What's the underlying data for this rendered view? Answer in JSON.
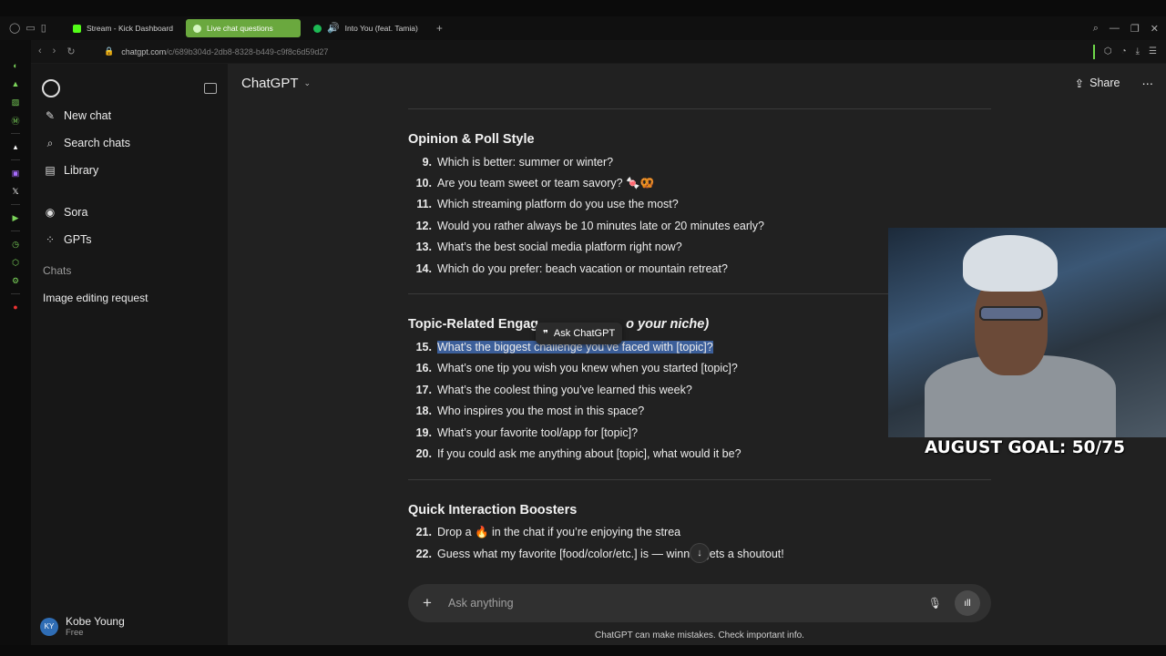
{
  "browser": {
    "tabs": [
      {
        "label": "Stream - Kick Dashboard"
      },
      {
        "label": "Live chat questions"
      },
      {
        "label": "Into You (feat. Tamia)"
      }
    ],
    "url_host": "chatgpt.com",
    "url_path": "/c/689b304d-2db8-8328-b449-c9f8c6d59d27"
  },
  "sidebar": {
    "items": [
      {
        "label": "New chat",
        "icon": "pencil-icon"
      },
      {
        "label": "Search chats",
        "icon": "search-icon"
      },
      {
        "label": "Library",
        "icon": "library-icon"
      },
      {
        "label": "Sora",
        "icon": "sora-icon"
      },
      {
        "label": "GPTs",
        "icon": "grid-icon"
      }
    ],
    "chats_heading": "Chats",
    "chats": [
      "Image editing request"
    ],
    "user": {
      "initials": "KY",
      "name": "Kobe Young",
      "plan": "Free"
    }
  },
  "header": {
    "model": "ChatGPT",
    "share_label": "Share"
  },
  "content": {
    "section1_title": "Opinion & Poll Style",
    "section1_items": [
      {
        "n": "9.",
        "text": "Which is better: summer or winter?"
      },
      {
        "n": "10.",
        "text": "Are you team sweet or team savory? 🍬🥨"
      },
      {
        "n": "11.",
        "text": "Which streaming platform do you use the most?"
      },
      {
        "n": "12.",
        "text": "Would you rather always be 10 minutes late or 20 minutes early?"
      },
      {
        "n": "13.",
        "text": "What’s the best social media platform right now?"
      },
      {
        "n": "14.",
        "text": "Which do you prefer: beach vacation or mountain retreat?"
      }
    ],
    "section2_title_start": "Topic-Related Engag",
    "section2_title_end": "o your niche)",
    "section2_items": [
      {
        "n": "15.",
        "text": "What’s the biggest challenge you’ve faced with [topic]?"
      },
      {
        "n": "16.",
        "text": "What’s one tip you wish you knew when you started [topic]?"
      },
      {
        "n": "17.",
        "text": "What’s the coolest thing you’ve learned this week?"
      },
      {
        "n": "18.",
        "text": "Who inspires you the most in this space?"
      },
      {
        "n": "19.",
        "text": "What’s your favorite tool/app for [topic]?"
      },
      {
        "n": "20.",
        "text": "If you could ask me anything about [topic], what would it be?"
      }
    ],
    "section3_title": "Quick Interaction Boosters",
    "section3_items": [
      {
        "n": "21.",
        "text": "Drop a 🔥 in the chat if you’re enjoying the strea"
      },
      {
        "n": "22.",
        "text": "Guess what my favorite [food/color/etc.] is — winner gets a shoutout!"
      }
    ],
    "ask_chatgpt_label": "Ask ChatGPT"
  },
  "composer": {
    "placeholder": "Ask anything"
  },
  "disclaimer": "ChatGPT can make mistakes. Check important info.",
  "overlay": {
    "goal_text": "AUGUST GOAL: 50/75"
  }
}
